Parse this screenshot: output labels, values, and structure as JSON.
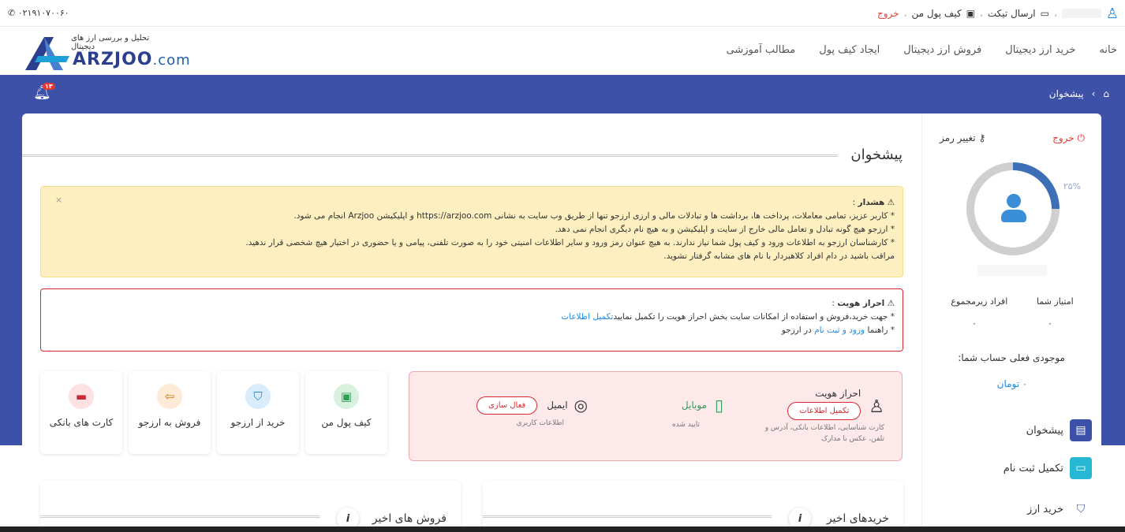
{
  "topbar": {
    "phone": "۰۲۱۹۱۰۷۰۰۶۰",
    "phone_icon": "phone-icon",
    "user_icon": "user-icon",
    "send_ticket": "ارسال تیکت",
    "wallet": "کیف پول من",
    "logout": "خروج"
  },
  "logo": {
    "tagline": "تحلیل و بررسی ارز های دیجیتال",
    "brand": "ARZJOO",
    "suffix": ".com"
  },
  "nav": {
    "items": [
      "خانه",
      "خرید ارز دیجیتال",
      "فروش ارز دیجیتال",
      "ایجاد کیف پول",
      "مطالب آموزشی"
    ]
  },
  "breadcrumb": {
    "home_icon": "home-icon",
    "sep": "›",
    "current": "پیشخوان"
  },
  "notifications": {
    "count": "۱۳"
  },
  "sidebar": {
    "logout": "خروج",
    "change_password": "تغییر رمز",
    "progress_label": "۲۵%",
    "progress": 0.25,
    "points_label": "امتیاز شما",
    "subs_label": "افراد زیرمجموع",
    "points_value": "۰",
    "subs_value": "۰",
    "balance_label": "موجودی فعلی حساب شما:",
    "balance_value": "۰ تومان",
    "menu": [
      "پیشخوان",
      "تکمیل ثبت نام",
      "خرید ارز"
    ]
  },
  "page": {
    "title": "پیشخوان"
  },
  "warning": {
    "close": "×",
    "heading": "هشدار",
    "line1": "* کاربر عزیز، تمامی معاملات، پرداخت ها، برداشت ها و تبادلات مالی و ارزی ارزجو تنها از طریق وب سایت به نشانی https://arzjoo.com و اپلیکیشن Arzjoo انجام می شود.",
    "line2": "* ارزجو هیچ گونه تبادل و تعامل مالی خارج از سایت و اپلیکیشن و به هیچ نام دیگری انجام نمی دهد.",
    "line3": "* کارشناسان ارزجو به اطلاعات ورود و کیف پول شما نیاز ندارند. به هیچ عنوان رمز ورود و سایر اطلاعات امنیتی خود را به صورت تلفنی، پیامی و یا حضوری در اختیار هیچ شخصی قرار ندهید.",
    "line4": "مراقب باشید در دام افراد کلاهبردار با نام های مشابه گرفتار نشوید."
  },
  "identity": {
    "heading": "احراز هویت",
    "line1": "* جهت خرید،فروش و استفاده از امکانات سایت بخش احراز هویت را تکمیل نمایید",
    "line1_link": "تکمیل اطلاعات",
    "line2_pre": "* راهنما",
    "line2_link": "ورود و ثبت نام",
    "line2_post": "در ارزجو"
  },
  "tiles": [
    {
      "label": "کیف پول من",
      "icon": "wallet-icon",
      "color": "#d8f1df",
      "fg": "#2e9d58"
    },
    {
      "label": "خرید از ارزجو",
      "icon": "shopping-bag-icon",
      "color": "#d9ecfb",
      "fg": "#2a8bd6"
    },
    {
      "label": "فروش به ارزجو",
      "icon": "sell-bag-icon",
      "color": "#fdebd7",
      "fg": "#cc7a1d"
    },
    {
      "label": "کارت های بانکی",
      "icon": "credit-card-icon",
      "color": "#fde1e3",
      "fg": "#c62b37"
    }
  ],
  "status": {
    "identity_title": "احراز هویت",
    "identity_button": "تکمیل اطلاعات",
    "identity_desc": "کارت شناسایی، اطلاعات بانکی، آدرس و تلفن، عکس با مدارک",
    "mobile_title": "موبایل",
    "mobile_desc": "تایید شده",
    "email_title": "ایمیل",
    "email_button": "فعال سازی",
    "email_desc": "اطلاعات کاربری"
  },
  "panels": {
    "recent_purchases": "خریدهای اخیر",
    "recent_sales": "فروش های اخیر",
    "info": "i"
  }
}
